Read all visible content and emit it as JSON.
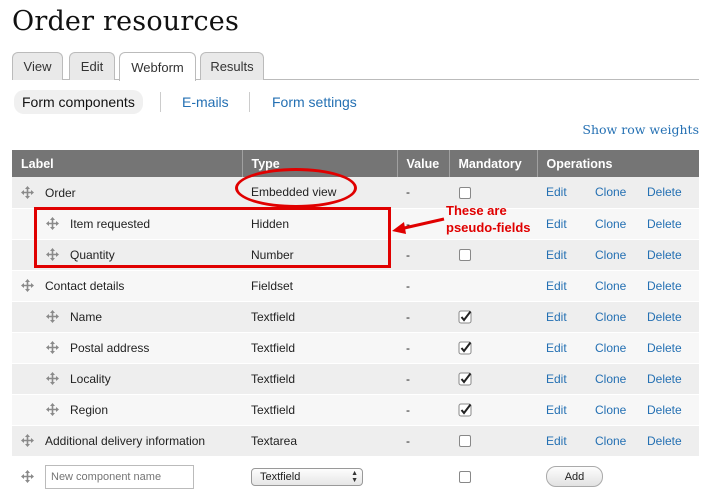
{
  "page_title": "Order resources",
  "tabs": [
    {
      "label": "View",
      "active": false
    },
    {
      "label": "Edit",
      "active": false
    },
    {
      "label": "Webform",
      "active": true
    },
    {
      "label": "Results",
      "active": false
    }
  ],
  "subtabs": [
    {
      "label": "Form components",
      "active": true
    },
    {
      "label": "E-mails",
      "active": false
    },
    {
      "label": "Form settings",
      "active": false
    }
  ],
  "row_weights_link": "Show row weights",
  "table": {
    "headers": [
      "Label",
      "Type",
      "Value",
      "Mandatory",
      "Operations"
    ],
    "rows": [
      {
        "label": "Order",
        "type": "Embedded view",
        "value": "-",
        "mandatory": "unchecked",
        "depth": 0
      },
      {
        "label": "Item requested",
        "type": "Hidden",
        "value": "-",
        "mandatory": "none",
        "depth": 1
      },
      {
        "label": "Quantity",
        "type": "Number",
        "value": "-",
        "mandatory": "unchecked",
        "depth": 1
      },
      {
        "label": "Contact details",
        "type": "Fieldset",
        "value": "-",
        "mandatory": "none",
        "depth": 0
      },
      {
        "label": "Name",
        "type": "Textfield",
        "value": "-",
        "mandatory": "checked",
        "depth": 1
      },
      {
        "label": "Postal address",
        "type": "Textfield",
        "value": "-",
        "mandatory": "checked",
        "depth": 1
      },
      {
        "label": "Locality",
        "type": "Textfield",
        "value": "-",
        "mandatory": "checked",
        "depth": 1
      },
      {
        "label": "Region",
        "type": "Textfield",
        "value": "-",
        "mandatory": "checked",
        "depth": 1
      },
      {
        "label": "Additional delivery information",
        "type": "Textarea",
        "value": "-",
        "mandatory": "unchecked",
        "depth": 0
      }
    ],
    "operations": [
      "Edit",
      "Clone",
      "Delete"
    ],
    "new_row": {
      "name_placeholder": "New component name",
      "type_selected": "Textfield",
      "add_label": "Add"
    }
  },
  "annotation": {
    "text": "These are pseudo-fields",
    "color": "#e00000"
  },
  "colors": {
    "link": "#2470b3",
    "header_bg": "#757575",
    "row_odd": "#eeeeee",
    "row_even": "#f7f7f7"
  }
}
